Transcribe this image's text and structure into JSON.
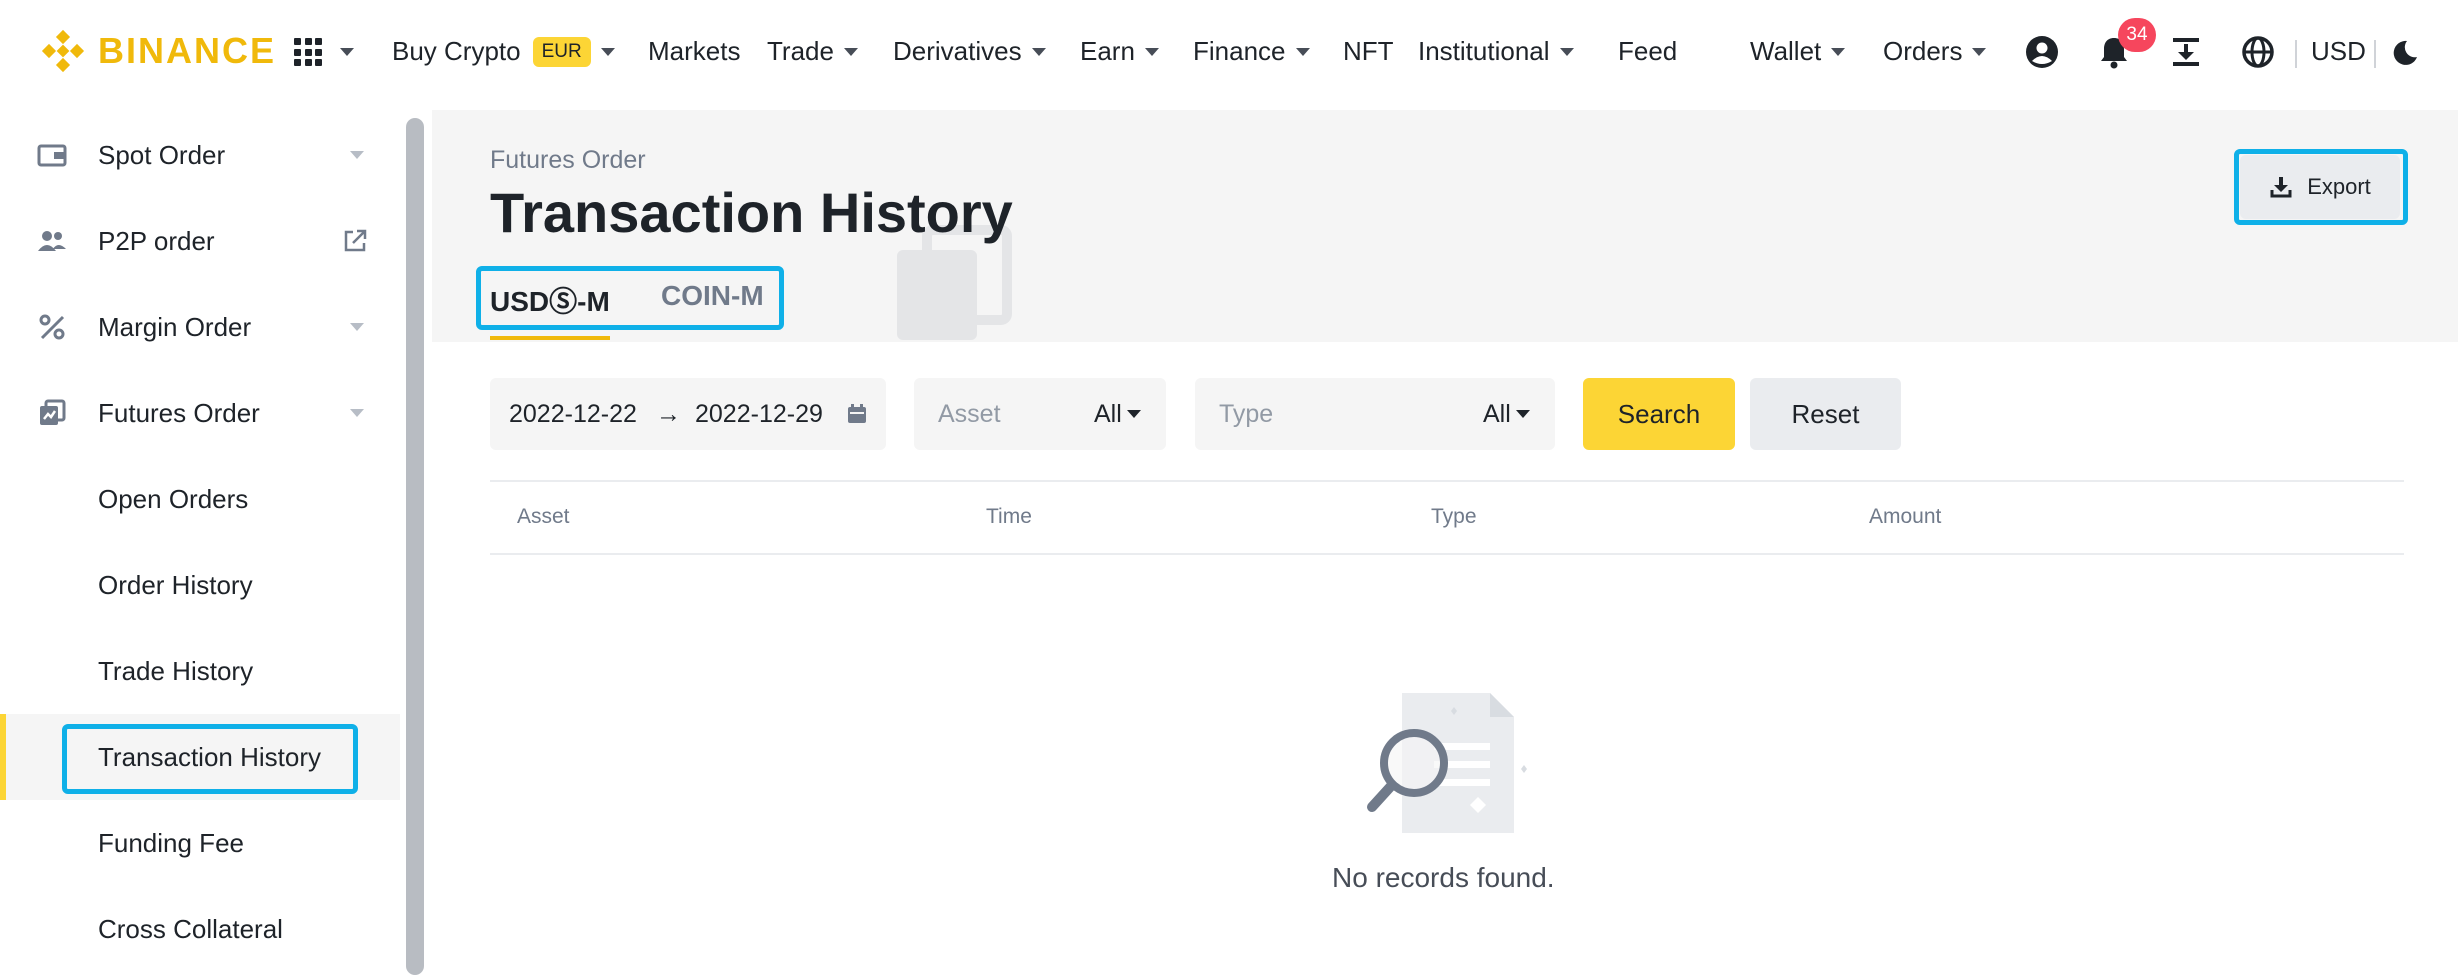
{
  "brand": {
    "name": "BINANCE",
    "color": "#f0b90b"
  },
  "nav": {
    "buy_crypto": "Buy Crypto",
    "currency_badge": "EUR",
    "markets": "Markets",
    "trade": "Trade",
    "derivatives": "Derivatives",
    "earn": "Earn",
    "finance": "Finance",
    "nft": "NFT",
    "institutional": "Institutional",
    "feed": "Feed",
    "wallet": "Wallet",
    "orders": "Orders",
    "notification_count": "34",
    "currency": "USD"
  },
  "sidebar": {
    "items": [
      {
        "label": "Spot Order",
        "icon": "wallet-card-icon"
      },
      {
        "label": "P2P order",
        "icon": "users-icon"
      },
      {
        "label": "Margin Order",
        "icon": "percent-icon"
      },
      {
        "label": "Futures Order",
        "icon": "futures-icon"
      },
      {
        "label": "Open Orders"
      },
      {
        "label": "Order History"
      },
      {
        "label": "Trade History"
      },
      {
        "label": "Transaction History"
      },
      {
        "label": "Funding Fee"
      },
      {
        "label": "Cross Collateral"
      }
    ]
  },
  "main": {
    "breadcrumb": "Futures Order",
    "title": "Transaction History",
    "tabs": [
      {
        "label": "USDⓈ-M"
      },
      {
        "label": "COIN-M"
      }
    ],
    "export_label": "Export",
    "filters": {
      "date_start": "2022-12-22",
      "date_arrow": "→",
      "date_end": "2022-12-29",
      "asset_placeholder": "Asset",
      "asset_value": "All",
      "type_placeholder": "Type",
      "type_value": "All",
      "search_label": "Search",
      "reset_label": "Reset"
    },
    "table": {
      "columns": [
        "Asset",
        "Time",
        "Type",
        "Amount"
      ],
      "rows": []
    },
    "empty_text": "No records found."
  },
  "colors": {
    "accent": "#fcd535",
    "highlight": "#0fb0e8",
    "notification": "#f6465d"
  }
}
